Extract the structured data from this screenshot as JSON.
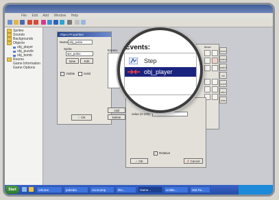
{
  "menubar": {
    "items": [
      "File",
      "Edit",
      "Add",
      "Window",
      "Help"
    ]
  },
  "tree": {
    "items": [
      "Sprites",
      "Sounds",
      "Backgrounds",
      "Objects",
      "Rooms",
      "Game Information",
      "Game Options"
    ],
    "objects": [
      "obj_player",
      "obj_puzzle",
      "obj_bomb"
    ]
  },
  "object_dialog": {
    "title": "Object Properties",
    "name_label": "Name:",
    "name_value": "obj_pokio",
    "sprite_label": "Sprite",
    "sprite_value": "spr_pokio",
    "new_button": "New",
    "edit_button": "Edit",
    "visible_label": "Visible",
    "solid_label": "Solid",
    "ok_button": "OK",
    "events_label": "Events:",
    "add_event_button": "Add",
    "delete_button": "Delete"
  },
  "magnifier": {
    "title": "Events:",
    "events": [
      {
        "label": "Step",
        "icon": "step-icon"
      },
      {
        "label": "obj_player",
        "icon": "collision-icon",
        "selected": true
      }
    ]
  },
  "value_dialog": {
    "value_label": "value (0-100):",
    "relative_label": "Relative",
    "ok_button": "OK",
    "cancel_button": "Cancel"
  },
  "action_panel": {
    "header": "Move",
    "tabs": [
      "move",
      "main1",
      "main2",
      "ctrl",
      "score",
      "extra",
      "draw"
    ]
  },
  "taskbar": {
    "start_label": "Start",
    "tasks": [
      "Volume",
      "pokedia",
      "Acrocomp",
      "Rtx...",
      "Game...",
      "Untitle...",
      "GM Pa..."
    ]
  },
  "colors": {
    "selection": "#1a237e",
    "title": "#3d5d9a",
    "taskbar": "#2a55b2"
  }
}
